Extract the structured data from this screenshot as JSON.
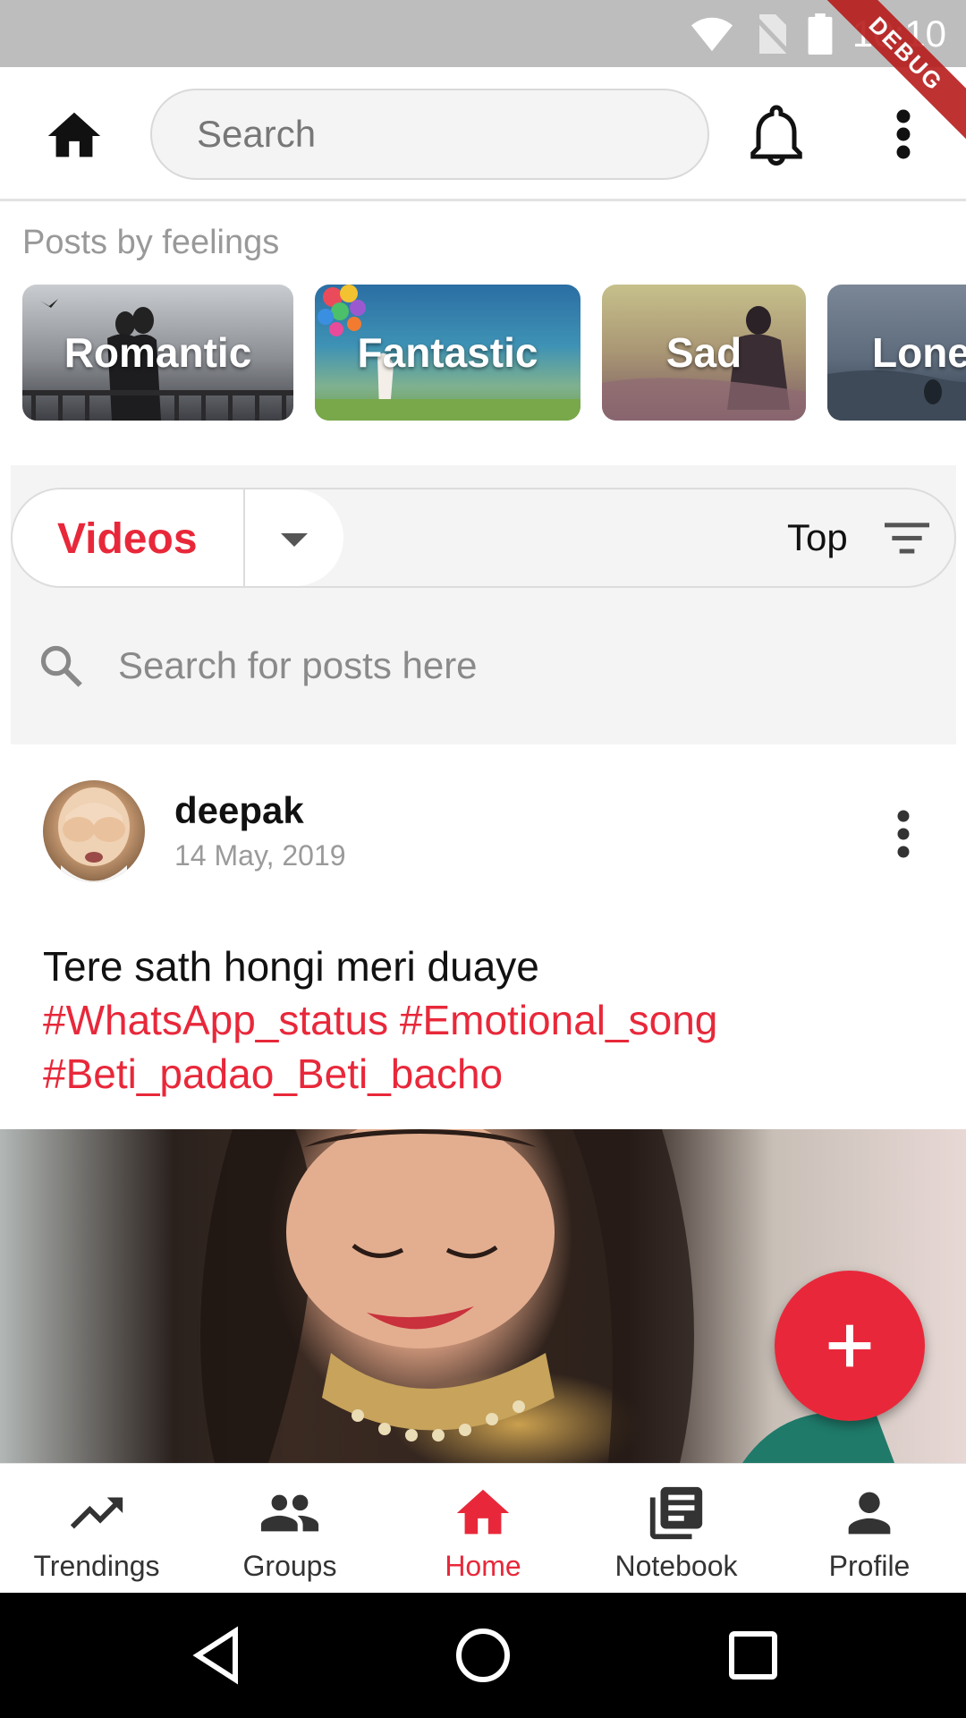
{
  "status_bar": {
    "time": "10:10"
  },
  "debug_banner": "DEBUG",
  "header": {
    "search_placeholder": "Search"
  },
  "feelings": {
    "title": "Posts by feelings",
    "items": [
      {
        "label": "Romantic"
      },
      {
        "label": "Fantastic"
      },
      {
        "label": "Sad"
      },
      {
        "label": "Lone"
      }
    ]
  },
  "filter": {
    "type_label": "Videos",
    "sort_label": "Top",
    "search_placeholder": "Search for posts here"
  },
  "post": {
    "author": "deepak",
    "date": "14 May, 2019",
    "text": "Tere sath hongi meri duaye",
    "tags": [
      "#WhatsApp_status",
      "#Emotional_song",
      "#Beti_padao_Beti_bacho"
    ]
  },
  "bottom_nav": {
    "items": [
      {
        "label": "Trendings",
        "icon": "trending-up-icon"
      },
      {
        "label": "Groups",
        "icon": "groups-icon"
      },
      {
        "label": "Home",
        "icon": "home-icon",
        "active": true
      },
      {
        "label": "Notebook",
        "icon": "notebook-icon"
      },
      {
        "label": "Profile",
        "icon": "person-icon"
      }
    ]
  },
  "colors": {
    "accent": "#e8283a",
    "status_bar": "#bdbdbd",
    "panel": "#f4f4f4"
  }
}
